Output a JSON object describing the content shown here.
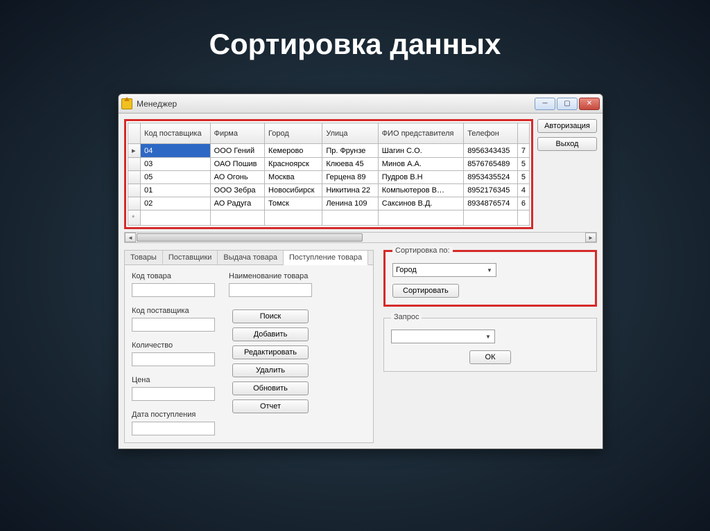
{
  "slide_title": "Сортировка данных",
  "window": {
    "title": "Менеджер",
    "buttons": {
      "auth": "Авторизация",
      "exit": "Выход"
    }
  },
  "table": {
    "headers": [
      "Код поставщика",
      "Фирма",
      "Город",
      "Улица",
      "ФИО представителя",
      "Телефон"
    ],
    "rows": [
      {
        "cells": [
          "04",
          "ООО Гений",
          "Кемерово",
          "Пр. Фрунзе",
          "Шагин С.О.",
          "8956343435",
          "7"
        ],
        "selected": true,
        "marker": "▸"
      },
      {
        "cells": [
          "03",
          "ОАО Пошив",
          "Красноярск",
          "Клюева 45",
          "Минов А.А.",
          "8576765489",
          "5"
        ],
        "marker": ""
      },
      {
        "cells": [
          "05",
          "АО Огонь",
          "Москва",
          "Герцена 89",
          "Пудров В.Н",
          "8953435524",
          "5"
        ],
        "marker": ""
      },
      {
        "cells": [
          "01",
          "ООО Зебра",
          "Новосибирск",
          "Никитина 22",
          "Компьютеров В…",
          "8952176345",
          "4"
        ],
        "marker": ""
      },
      {
        "cells": [
          "02",
          "АО Радуга",
          "Томск",
          "Ленина 109",
          "Саксинов В.Д.",
          "8934876574",
          "6"
        ],
        "marker": ""
      }
    ],
    "new_row_marker": "*"
  },
  "tabs": {
    "items": [
      "Товары",
      "Поставщики",
      "Выдача товара",
      "Поступление товара"
    ],
    "active_index": 3
  },
  "form": {
    "left_labels": [
      "Код товара",
      "Код поставщика",
      "Количество",
      "Цена",
      "Дата поступления"
    ],
    "right_label": "Наименование товара",
    "buttons": [
      "Поиск",
      "Добавить",
      "Редактировать",
      "Удалить",
      "Обновить",
      "Отчет"
    ]
  },
  "sort_box": {
    "legend": "Сортировка по:",
    "combo_value": "Город",
    "button": "Сортировать"
  },
  "query_box": {
    "legend": "Запрос",
    "combo_value": "",
    "button": "ОК"
  }
}
